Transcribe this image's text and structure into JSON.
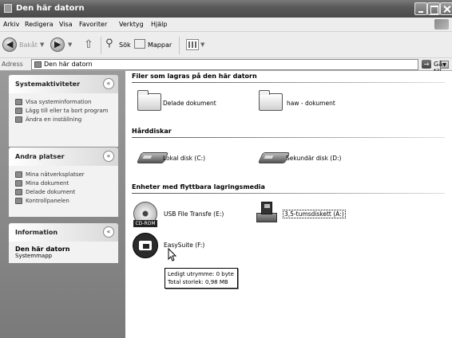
{
  "window": {
    "title": "Den här datorn"
  },
  "menu": [
    "Arkiv",
    "Redigera",
    "Visa",
    "Favoriter",
    "Verktyg",
    "Hjälp"
  ],
  "toolbar": {
    "back": "Bakåt",
    "search": "Sök",
    "folders": "Mappar"
  },
  "address": {
    "label": "Adress",
    "value": "Den här datorn",
    "go": "Gå till"
  },
  "sidebar": {
    "system_tasks": {
      "title": "Systemaktiviteter",
      "items": [
        "Visa systeminformation",
        "Lägg till eller ta bort program",
        "Ändra en inställning"
      ]
    },
    "other_places": {
      "title": "Andra platser",
      "items": [
        "Mina nätverksplatser",
        "Mina dokument",
        "Delade dokument",
        "Kontrollpanelen"
      ]
    },
    "information": {
      "title": "Information",
      "name": "Den här datorn",
      "type": "Systemmapp"
    }
  },
  "main": {
    "group_files": "Filer som lagras på den här datorn",
    "files": [
      "Delade dokument",
      "haw - dokument"
    ],
    "group_drives": "Hårddiskar",
    "drives": [
      "Lokal disk (C:)",
      "Sekundär disk (D:)"
    ],
    "group_removable": "Enheter med flyttbara lagringsmedia",
    "removable": [
      "USB File Transfe (E:)",
      "3,5-tumsdiskett (A:)",
      "EasySuite (F:)"
    ],
    "cd_badge": "CD-ROM",
    "tooltip": {
      "line1": "Ledigt utrymme: 0 byte",
      "line2": "Total storlek: 0,98 MB"
    }
  }
}
